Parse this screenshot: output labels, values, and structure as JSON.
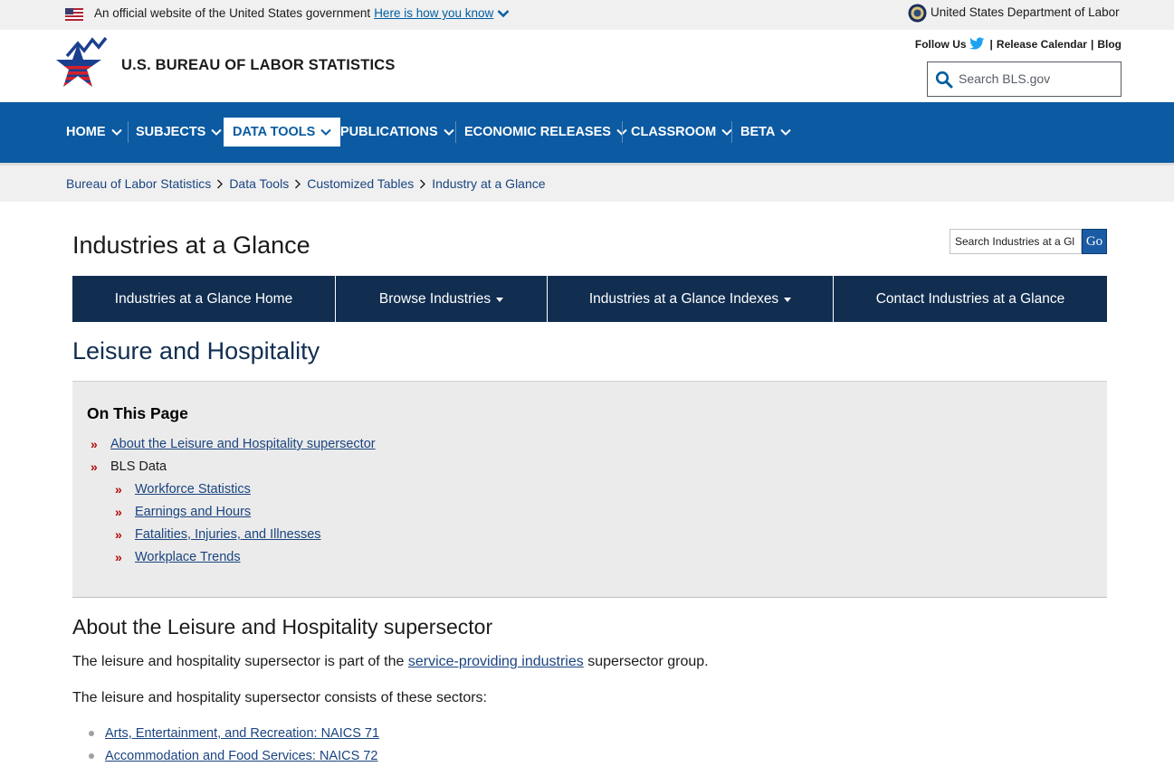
{
  "gov_banner": {
    "text": "An official website of the United States government",
    "link": "Here is how you know",
    "dol": "United States Department of Labor"
  },
  "header": {
    "site_title": "U.S. BUREAU OF LABOR STATISTICS",
    "follow_us": "Follow Us",
    "release_calendar": "Release Calendar",
    "blog": "Blog",
    "separator": "|",
    "search_placeholder": "Search BLS.gov"
  },
  "nav": {
    "items": [
      "HOME",
      "SUBJECTS",
      "DATA TOOLS",
      "PUBLICATIONS",
      "ECONOMIC RELEASES",
      "CLASSROOM",
      "BETA"
    ],
    "active": "DATA TOOLS"
  },
  "breadcrumb": [
    "Bureau of Labor Statistics",
    "Data Tools",
    "Customized Tables",
    "Industry at a Glance"
  ],
  "page": {
    "heading": "Industries at a Glance",
    "search_value": "Search Industries at a Gl",
    "go_label": "Go"
  },
  "subnav": {
    "items": [
      "Industries at a Glance Home",
      "Browse Industries",
      "Industries at a Glance Indexes",
      "Contact Industries at a Glance"
    ]
  },
  "section": {
    "heading": "Leisure and Hospitality"
  },
  "on_this_page": {
    "title": "On This Page",
    "items": [
      {
        "label": "About the Leisure and Hospitality supersector"
      },
      {
        "label": "BLS Data"
      },
      {
        "label": "Workforce Statistics"
      },
      {
        "label": "Earnings and Hours"
      },
      {
        "label": "Fatalities, Injuries, and Illnesses"
      },
      {
        "label": "Workplace Trends"
      }
    ]
  },
  "about": {
    "heading": "About the Leisure and Hospitality supersector",
    "para1_before": "The leisure and hospitality supersector is part of the",
    "para1_link": "service-providing industries",
    "para1_after": "supersector group.",
    "para2": "The leisure and hospitality supersector consists of these sectors:",
    "sectors": [
      "Arts, Entertainment, and Recreation: NAICS 71",
      "Accommodation and Food Services: NAICS 72"
    ]
  },
  "colors": {
    "nav_blue": "#0b5aa2",
    "subnav_navy": "#112e51",
    "link_blue": "#1a4480",
    "raquo_red": "#b50909"
  }
}
